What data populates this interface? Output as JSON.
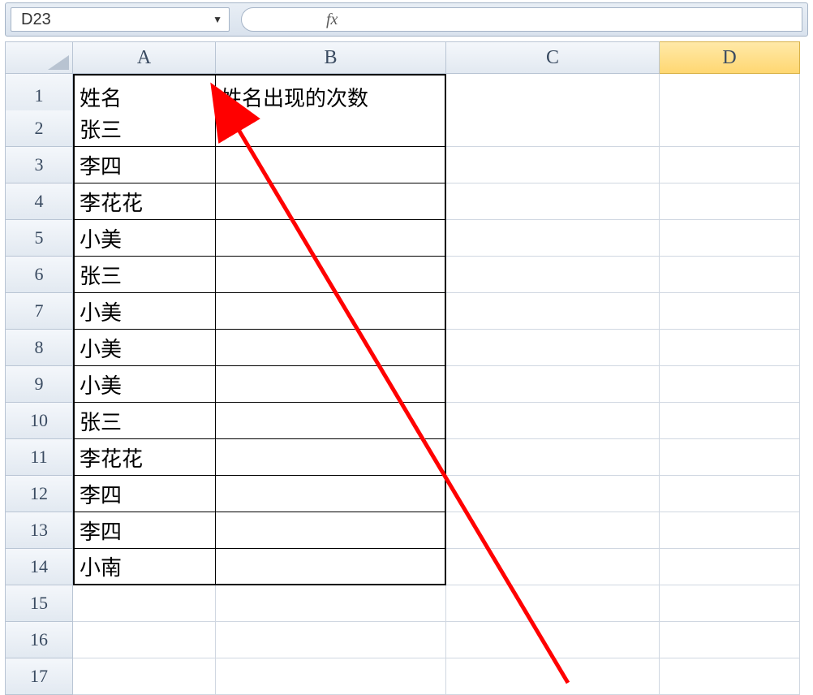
{
  "nameBox": {
    "value": "D23"
  },
  "fx": {
    "label": "fx",
    "value": ""
  },
  "columns": [
    "A",
    "B",
    "C",
    "D"
  ],
  "activeColumn": "D",
  "rowNumbers": [
    1,
    2,
    3,
    4,
    5,
    6,
    7,
    8,
    9,
    10,
    11,
    12,
    13,
    14,
    15,
    16,
    17
  ],
  "table": {
    "headerA": "姓名",
    "headerB": "姓名出现的次数",
    "rows": [
      "张三",
      "李四",
      "李花花",
      "小美",
      "张三",
      "小美",
      "小美",
      "小美",
      "张三",
      "李花花",
      "李四",
      "李四",
      "小南"
    ]
  },
  "annotation": {
    "color": "#ff0000"
  }
}
